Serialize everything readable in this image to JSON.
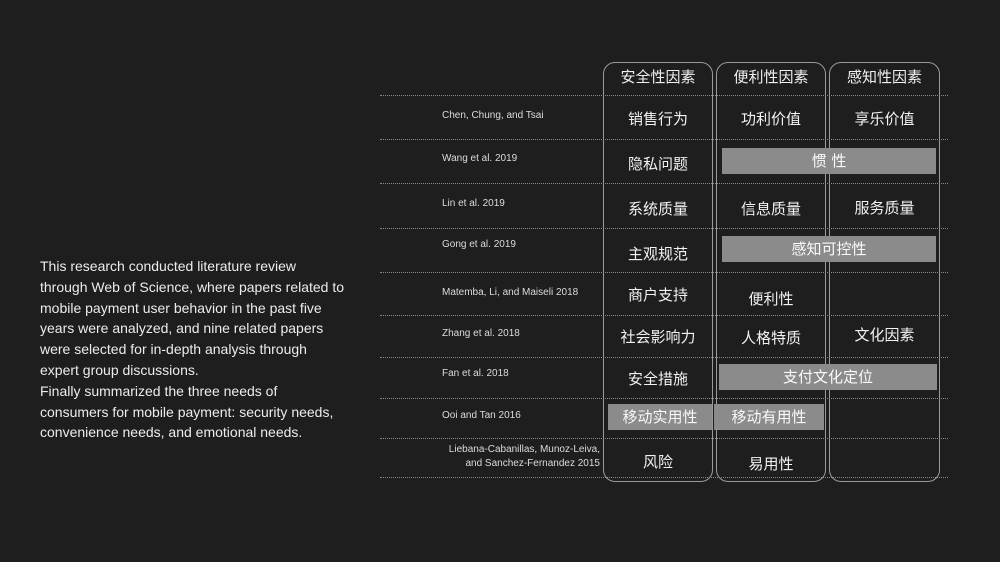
{
  "description": {
    "para1": "This research conducted literature review through Web of Science, where papers related to mobile payment user behavior in the past five years were analyzed, and nine related papers were selected for in-depth analysis through expert group discussions.",
    "para2": "Finally summarized the three needs of consumers for mobile payment: security needs, convenience needs, and emotional needs."
  },
  "table": {
    "headers": [
      "安全性因素",
      "便利性因素",
      "感知性因素"
    ],
    "rows": [
      {
        "author": "Chen,  Chung,  and  Tsai",
        "security": "销售行为",
        "convenience": "功利价值",
        "perception": "享乐价值"
      },
      {
        "author": "Wang et al. 2019",
        "security": "隐私问题",
        "span": "惯  性"
      },
      {
        "author": "Lin et al. 2019",
        "security": "系统质量",
        "convenience": "信息质量",
        "perception": "服务质量"
      },
      {
        "author": "Gong et al. 2019",
        "security": "主观规范",
        "span": "感知可控性"
      },
      {
        "author": "Matemba, Li, and Maiseli 2018",
        "security": "商户支持",
        "convenience": "便利性"
      },
      {
        "author": "Zhang et al. 2018",
        "security": "社会影响力",
        "convenience": "人格特质",
        "perception": "文化因素"
      },
      {
        "author": "Fan et al. 2018",
        "security": "安全措施",
        "span": "支付文化定位"
      },
      {
        "author": "Ooi and Tan 2016",
        "security": "移动实用性",
        "convenience": "移动有用性"
      },
      {
        "author_line1": "Liebana-Cabanillas, Munoz-Leiva,",
        "author_line2": "and Sanchez-Fernandez 2015",
        "security": "风险",
        "convenience": "易用性"
      }
    ]
  }
}
